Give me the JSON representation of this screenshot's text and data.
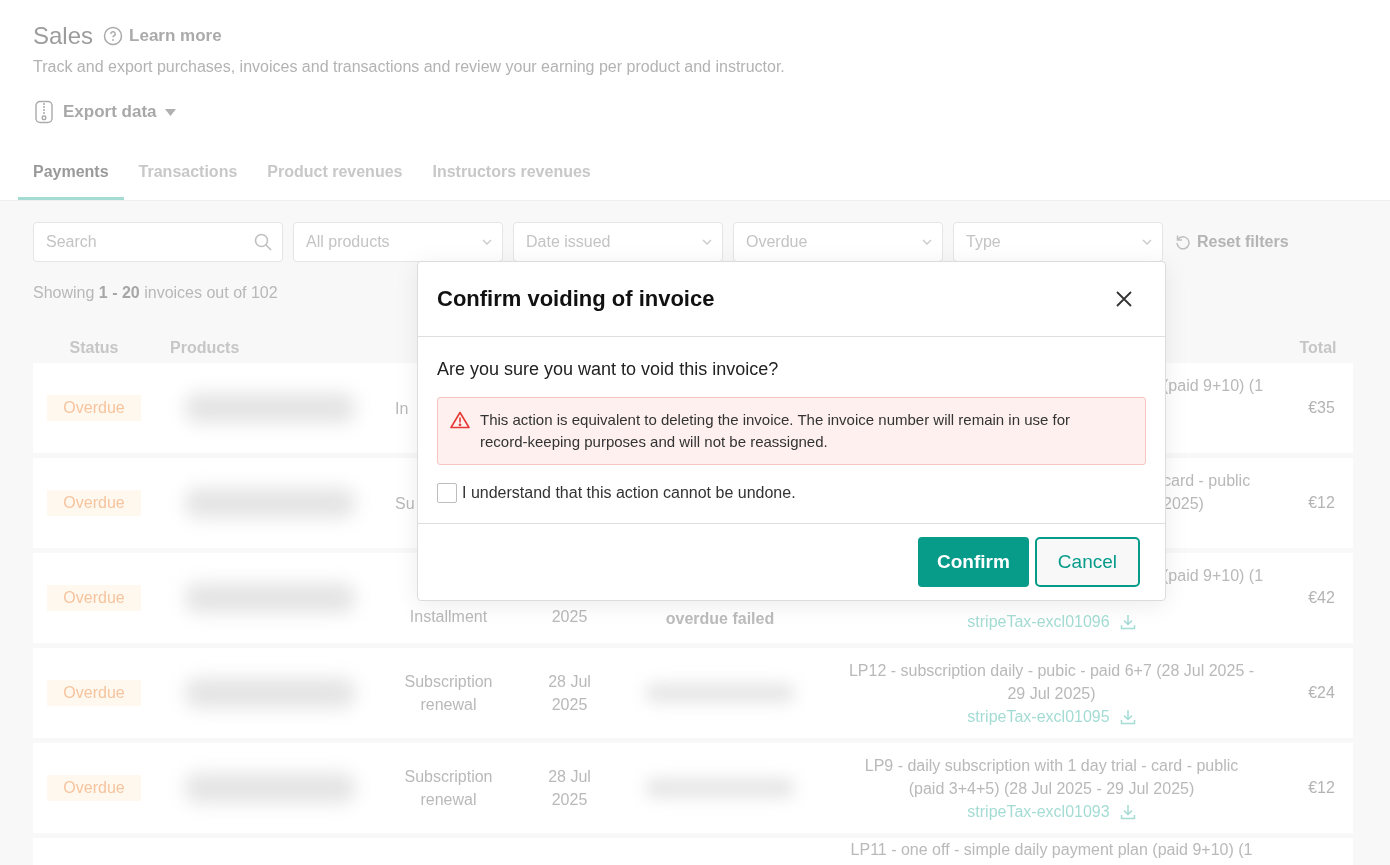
{
  "page": {
    "title": "Sales",
    "learn_more": "Learn more",
    "subtitle": "Track and export purchases, invoices and transactions and review your earning per product and instructor.",
    "export_button": "Export data"
  },
  "tabs": [
    {
      "label": "Payments",
      "selected": true
    },
    {
      "label": "Transactions",
      "selected": false
    },
    {
      "label": "Product revenues",
      "selected": false
    },
    {
      "label": "Instructors revenues",
      "selected": false
    }
  ],
  "filters": {
    "search": {
      "placeholder": "Search"
    },
    "dropdowns": [
      {
        "placeholder": "All products"
      },
      {
        "placeholder": "Date issued"
      },
      {
        "placeholder": "Overdue"
      },
      {
        "placeholder": "Type"
      }
    ],
    "reset": "Reset filters"
  },
  "summary": "Showing **1 - 20** invoices out of 102",
  "table": {
    "columns": {
      "status": "Status",
      "products": "Products",
      "total": "Total"
    },
    "rows": [
      {
        "status": "Overdue",
        "type": "In",
        "description_lines": [
          "(paid 9+10) (1"
        ],
        "total": "€35"
      },
      {
        "status": "Overdue",
        "type": "Su",
        "description_lines": [
          "card - public",
          "2025)"
        ],
        "total": "€12"
      },
      {
        "status": "Overdue",
        "type": "Installment",
        "date": "2025",
        "reference": {
          "kind": "text",
          "text": "overdue failed"
        },
        "description_lines": [
          "(paid 9+10) (1"
        ],
        "invoice": "stripeTax-excl01096",
        "total": "€42"
      },
      {
        "status": "Overdue",
        "type": "Subscription renewal",
        "date": "28 Jul 2025",
        "reference": {
          "kind": "blurred"
        },
        "description_lines": [
          "LP12 - subscription daily - pubic - paid 6+7 (28 Jul 2025 -",
          "29 Jul 2025)"
        ],
        "invoice": "stripeTax-excl01095",
        "total": "€24"
      },
      {
        "status": "Overdue",
        "type": "Subscription renewal",
        "date": "28 Jul 2025",
        "reference": {
          "kind": "blurred"
        },
        "description_lines": [
          "LP9 - daily subscription with 1 day trial - card - public",
          "(paid 3+4+5) (28 Jul 2025 - 29 Jul 2025)"
        ],
        "invoice": "stripeTax-excl01093",
        "total": "€12"
      },
      {
        "description_lines": [
          "LP11 - one off - simple daily payment plan (paid 9+10) (1"
        ]
      }
    ]
  },
  "dialog": {
    "title": "Confirm voiding of invoice",
    "question": "Are you sure you want to void this invoice?",
    "warning": "This action is equivalent to deleting the invoice. The invoice number will remain in use for record-keeping purposes and will not be reassigned.",
    "checkbox": {
      "label": "I understand that this action cannot be undone.",
      "checked": false
    },
    "confirm": "Confirm",
    "cancel": "Cancel"
  }
}
